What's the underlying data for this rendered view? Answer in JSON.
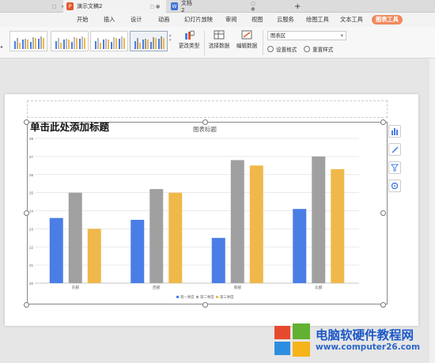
{
  "tabs": {
    "doc1": {
      "title": "演示文稿2",
      "icon": "P",
      "icon_color": "#e2592f"
    },
    "doc2": {
      "title": "文档2",
      "icon": "W",
      "icon_color": "#3b74d6"
    },
    "new_tab": "+"
  },
  "menu": [
    "开始",
    "插入",
    "设计",
    "动画",
    "幻灯片放映",
    "审阅",
    "视图",
    "云服务",
    "绘图工具",
    "文本工具",
    "图表工具"
  ],
  "ribbon": {
    "change_type": "更改类型",
    "select_data": "选择数据",
    "edit_data": "编辑数据",
    "chart_area": "图表区",
    "set_format": "设置格式",
    "reset_style": "重置样式"
  },
  "slide": {
    "placeholder_title": "单击此处添加标题"
  },
  "chart_data": {
    "type": "bar",
    "title": "图表标题",
    "categories": [
      "东部",
      "西部",
      "南部",
      "北部"
    ],
    "series": [
      {
        "name": "第一季度",
        "color": "#4a7de6",
        "values": [
          23.6,
          23.5,
          22.5,
          24.1
        ]
      },
      {
        "name": "第二季度",
        "color": "#a0a0a0",
        "values": [
          25,
          25.2,
          26.8,
          27
        ]
      },
      {
        "name": "第三季度",
        "color": "#f0b84a",
        "values": [
          23,
          25,
          26.5,
          26.3
        ]
      }
    ],
    "ylim": [
      20,
      28
    ],
    "yticks": [
      "20",
      "21",
      "22",
      "23",
      "24",
      "25",
      "26",
      "27",
      "28"
    ],
    "grid": true,
    "legend": "bottom"
  },
  "watermark": {
    "line1": "电脑软硬件教程网",
    "line2": "www.computer26.com"
  }
}
